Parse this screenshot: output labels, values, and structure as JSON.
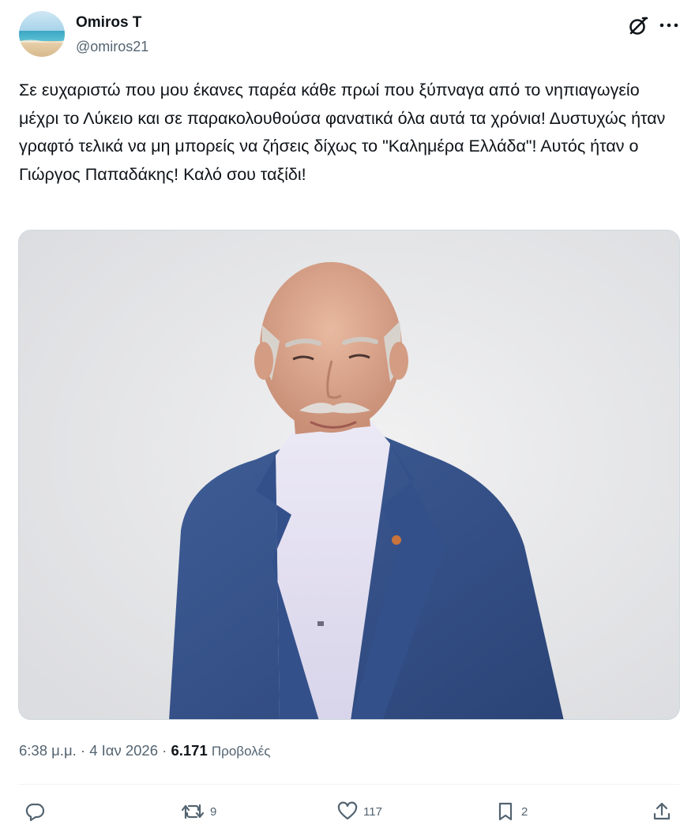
{
  "author": {
    "display_name": "Omiros T",
    "handle": "@omiros21"
  },
  "tweet": {
    "text": "Σε ευχαριστώ που μου έκανες παρέα κάθε πρωί που ξύπναγα από το νηπιαγωγείο μέχρι το Λύκειο και σε παρακολουθούσα φανατικά όλα αυτά τα χρόνια! Δυστυχώς ήταν γραφτό τελικά να μη μπορείς να ζήσεις δίχως το \"Καλημέρα Ελλάδα\"! Αυτός ήταν ο Γιώργος Παπαδάκης! Καλό σου ταξίδι!"
  },
  "meta": {
    "time": "6:38 μ.μ.",
    "separator": "·",
    "date": "4 Ιαν 2026",
    "views": "6.171",
    "views_label": "Προβολές"
  },
  "actions": {
    "reply_count": "",
    "retweet_count": "9",
    "like_count": "117",
    "bookmark_count": "2"
  },
  "icons": {
    "grok": "grok-icon",
    "more": "more-icon",
    "reply": "reply-icon",
    "retweet": "retweet-icon",
    "like": "heart-icon",
    "bookmark": "bookmark-icon",
    "share": "share-icon"
  },
  "colors": {
    "text_primary": "#0f1419",
    "text_secondary": "#536471",
    "border": "#cfd9de",
    "divider": "#eff3f4"
  }
}
